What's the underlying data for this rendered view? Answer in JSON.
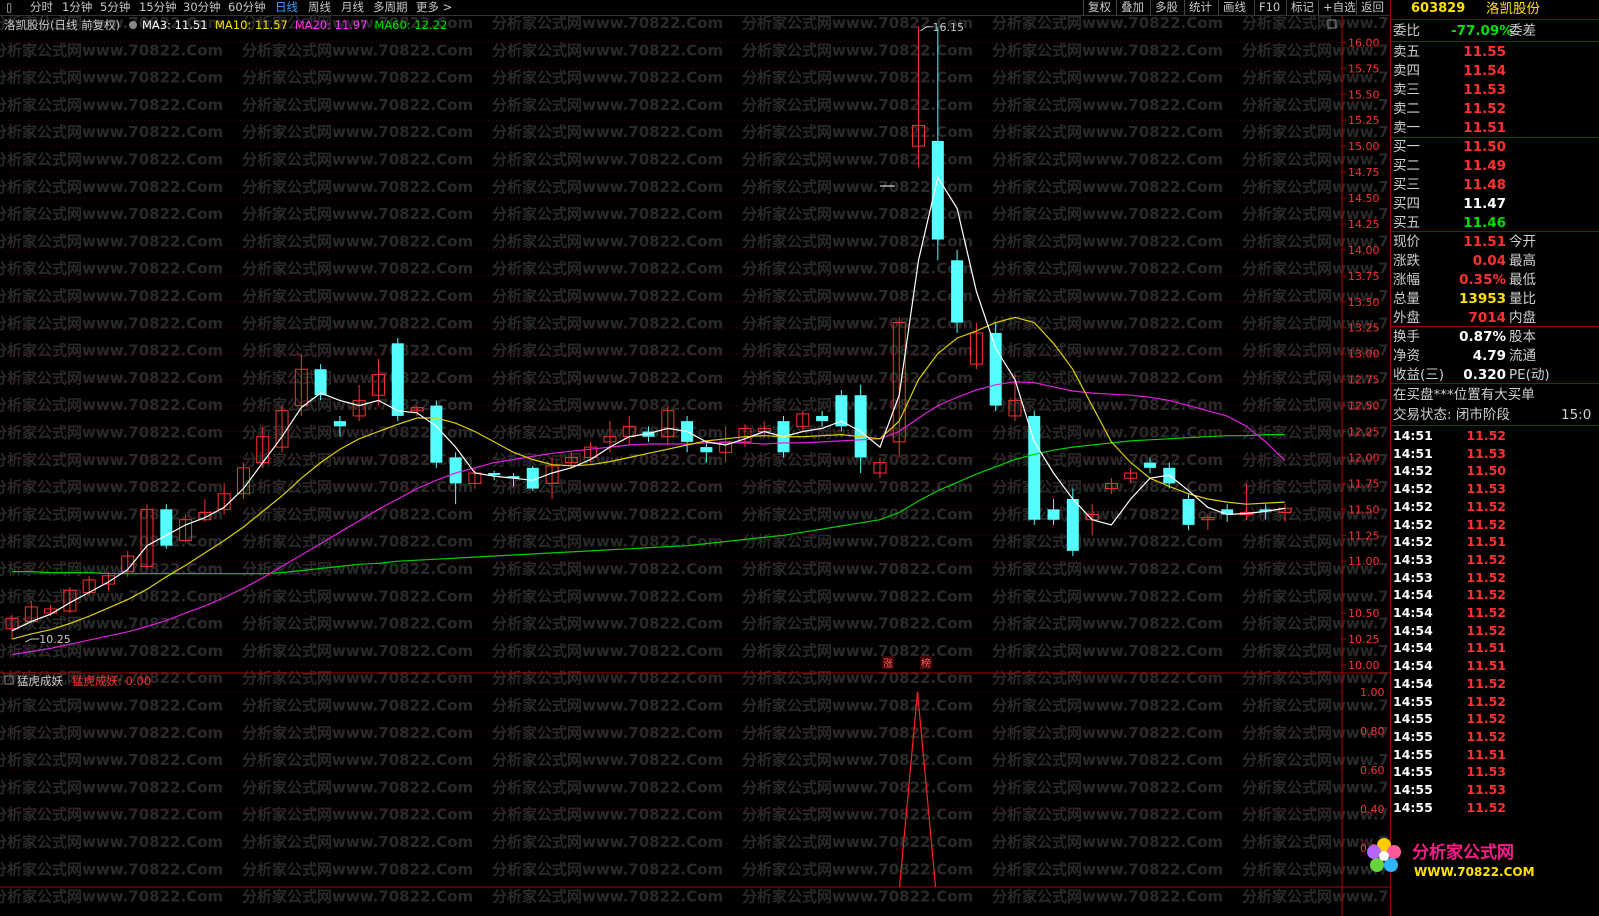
{
  "toolbar": {
    "periods": [
      "分时",
      "1分钟",
      "5分钟",
      "15分钟",
      "30分钟",
      "60分钟",
      "日线",
      "周线",
      "月线",
      "多周期",
      "更多 >"
    ],
    "active_period": "日线",
    "right": [
      "复权",
      "叠加",
      "多股",
      "统计",
      "画线",
      "F10",
      "标记",
      "+自选",
      "返回"
    ]
  },
  "main": {
    "title": "洛凯股份(日线 前复权)",
    "ma_labels": [
      {
        "text": "MA3: 11.51",
        "color": "#ffffff"
      },
      {
        "text": "MA10: 11.57",
        "color": "#ffe000"
      },
      {
        "text": "MA20: 11.97",
        "color": "#ff33ff"
      },
      {
        "text": "MA60: 12.22",
        "color": "#00e000"
      }
    ],
    "high_marker": "16.15",
    "low_marker": "10.25",
    "y_ticks": [
      "16.00",
      "15.75",
      "15.50",
      "15.25",
      "15.00",
      "14.75",
      "14.50",
      "14.25",
      "14.00",
      "13.75",
      "13.50",
      "13.25",
      "13.00",
      "12.75",
      "12.50",
      "12.25",
      "12.00",
      "11.75",
      "11.50",
      "11.25",
      "11.00",
      "10.50",
      "10.25",
      "10.00"
    ],
    "tags": [
      "涨",
      "榜"
    ]
  },
  "indicator": {
    "title": "猛虎成妖",
    "value_label": "猛虎成妖: 0.00",
    "y_ticks": [
      "1.00",
      "0.80",
      "0.60",
      "0.40",
      "0.20"
    ]
  },
  "watermark": "分析家公式网www.70822.Com",
  "panel": {
    "code": "603829",
    "name": "洛凯股份",
    "weibi_label": "委比",
    "weibi_value": "-77.09%",
    "weicha_label": "委差",
    "asks": [
      {
        "label": "卖五",
        "price": "11.55"
      },
      {
        "label": "卖四",
        "price": "11.54"
      },
      {
        "label": "卖三",
        "price": "11.53"
      },
      {
        "label": "卖二",
        "price": "11.52"
      },
      {
        "label": "卖一",
        "price": "11.51"
      }
    ],
    "bids": [
      {
        "label": "买一",
        "price": "11.50",
        "color": "red"
      },
      {
        "label": "买二",
        "price": "11.49",
        "color": "red"
      },
      {
        "label": "买三",
        "price": "11.48",
        "color": "red"
      },
      {
        "label": "买四",
        "price": "11.47",
        "color": "white"
      },
      {
        "label": "买五",
        "price": "11.46",
        "color": "green"
      }
    ],
    "stats": [
      {
        "label": "现价",
        "value": "11.51",
        "color": "red",
        "label2": "今开"
      },
      {
        "label": "涨跌",
        "value": "0.04",
        "color": "red",
        "label2": "最高"
      },
      {
        "label": "涨幅",
        "value": "0.35%",
        "color": "red",
        "label2": "最低"
      },
      {
        "label": "总量",
        "value": "13953",
        "color": "yellow",
        "label2": "量比"
      },
      {
        "label": "外盘",
        "value": "7014",
        "color": "red",
        "label2": "内盘"
      }
    ],
    "stats2": [
      {
        "label": "换手",
        "value": "0.87%",
        "label2": "股本"
      },
      {
        "label": "净资",
        "value": "4.79",
        "label2": "流通"
      },
      {
        "label": "收益(三)",
        "value": "0.320",
        "label2": "PE(动)"
      }
    ],
    "notice": "在买盘***位置有大买单",
    "status": "交易状态: 闭市阶段",
    "status_time": "15:0",
    "ticks": [
      {
        "time": "14:51",
        "price": "11.52"
      },
      {
        "time": "14:51",
        "price": "11.53"
      },
      {
        "time": "14:52",
        "price": "11.50"
      },
      {
        "time": "14:52",
        "price": "11.53"
      },
      {
        "time": "14:52",
        "price": "11.52"
      },
      {
        "time": "14:52",
        "price": "11.52"
      },
      {
        "time": "14:52",
        "price": "11.51"
      },
      {
        "time": "14:53",
        "price": "11.52"
      },
      {
        "time": "14:53",
        "price": "11.52"
      },
      {
        "time": "14:54",
        "price": "11.52"
      },
      {
        "time": "14:54",
        "price": "11.52"
      },
      {
        "time": "14:54",
        "price": "11.52"
      },
      {
        "time": "14:54",
        "price": "11.51"
      },
      {
        "time": "14:54",
        "price": "11.51"
      },
      {
        "time": "14:54",
        "price": "11.52"
      },
      {
        "time": "14:55",
        "price": "11.52"
      },
      {
        "time": "14:55",
        "price": "11.52"
      },
      {
        "time": "14:55",
        "price": "11.52"
      },
      {
        "time": "14:55",
        "price": "11.51"
      },
      {
        "time": "14:55",
        "price": "11.53"
      },
      {
        "time": "14:55",
        "price": "11.53"
      },
      {
        "time": "14:55",
        "price": "11.52"
      }
    ],
    "logo_text": "分析家公式网",
    "logo_url": "WWW.70822.COM"
  },
  "chart_data": {
    "type": "candlestick",
    "ylim": [
      10.0,
      16.1
    ],
    "candles": [
      [
        10.35,
        10.45,
        10.25,
        10.48
      ],
      [
        10.42,
        10.56,
        10.4,
        10.62
      ],
      [
        10.5,
        10.54,
        10.47,
        10.58
      ],
      [
        10.52,
        10.72,
        10.5,
        10.75
      ],
      [
        10.7,
        10.82,
        10.68,
        10.86
      ],
      [
        10.78,
        10.86,
        10.72,
        10.9
      ],
      [
        10.9,
        11.05,
        10.85,
        11.1
      ],
      [
        10.95,
        11.5,
        10.93,
        11.55
      ],
      [
        11.5,
        11.15,
        11.12,
        11.55
      ],
      [
        11.2,
        11.4,
        11.18,
        11.45
      ],
      [
        11.4,
        11.47,
        11.38,
        11.6
      ],
      [
        11.5,
        11.65,
        11.45,
        11.75
      ],
      [
        11.65,
        11.9,
        11.6,
        11.95
      ],
      [
        11.95,
        12.2,
        11.9,
        12.3
      ],
      [
        12.1,
        12.45,
        12.05,
        12.5
      ],
      [
        12.5,
        12.85,
        12.4,
        13.0
      ],
      [
        12.85,
        12.6,
        12.55,
        12.9
      ],
      [
        12.35,
        12.3,
        12.2,
        12.4
      ],
      [
        12.4,
        12.55,
        12.35,
        12.7
      ],
      [
        12.6,
        12.8,
        12.5,
        12.95
      ],
      [
        13.1,
        12.4,
        12.35,
        13.15
      ],
      [
        12.45,
        12.48,
        12.4,
        12.5
      ],
      [
        12.5,
        11.95,
        11.9,
        12.55
      ],
      [
        12.0,
        11.75,
        11.55,
        12.05
      ],
      [
        11.75,
        11.85,
        11.7,
        11.9
      ],
      [
        11.85,
        11.83,
        11.78,
        11.87
      ],
      [
        11.82,
        11.8,
        11.72,
        11.85
      ],
      [
        11.9,
        11.7,
        11.68,
        11.92
      ],
      [
        11.75,
        11.92,
        11.6,
        12.0
      ],
      [
        11.95,
        12.0,
        11.9,
        12.05
      ],
      [
        12.0,
        12.1,
        11.95,
        12.15
      ],
      [
        12.15,
        12.2,
        12.05,
        12.35
      ],
      [
        12.2,
        12.3,
        12.12,
        12.4
      ],
      [
        12.25,
        12.2,
        12.15,
        12.3
      ],
      [
        12.2,
        12.45,
        12.12,
        12.5
      ],
      [
        12.35,
        12.15,
        12.05,
        12.4
      ],
      [
        12.1,
        12.05,
        11.95,
        12.15
      ],
      [
        12.05,
        12.15,
        11.95,
        12.3
      ],
      [
        12.15,
        12.28,
        12.1,
        12.32
      ],
      [
        12.25,
        12.28,
        12.2,
        12.35
      ],
      [
        12.35,
        12.05,
        12.0,
        12.4
      ],
      [
        12.3,
        12.42,
        12.25,
        12.45
      ],
      [
        12.4,
        12.35,
        12.3,
        12.45
      ],
      [
        12.6,
        12.3,
        12.25,
        12.65
      ],
      [
        12.6,
        12.0,
        11.85,
        12.7
      ],
      [
        11.85,
        11.95,
        11.8,
        12.0
      ],
      [
        12.15,
        13.3,
        12.0,
        13.35
      ],
      [
        15.0,
        15.2,
        14.8,
        16.15
      ],
      [
        15.05,
        14.1,
        13.9,
        16.15
      ],
      [
        13.9,
        13.3,
        13.2,
        14.0
      ],
      [
        12.9,
        13.2,
        12.85,
        13.3
      ],
      [
        13.2,
        12.5,
        12.45,
        13.3
      ],
      [
        12.4,
        12.55,
        12.35,
        12.8
      ],
      [
        12.4,
        11.4,
        11.35,
        12.45
      ],
      [
        11.5,
        11.4,
        11.35,
        11.6
      ],
      [
        11.6,
        11.1,
        11.05,
        11.7
      ],
      [
        11.4,
        11.45,
        11.25,
        11.55
      ],
      [
        11.7,
        11.75,
        11.65,
        11.8
      ],
      [
        11.8,
        11.85,
        11.75,
        11.9
      ],
      [
        11.95,
        11.9,
        11.85,
        12.0
      ],
      [
        11.9,
        11.75,
        11.7,
        11.95
      ],
      [
        11.6,
        11.35,
        11.3,
        11.65
      ],
      [
        11.4,
        11.42,
        11.3,
        11.45
      ],
      [
        11.5,
        11.45,
        11.38,
        11.55
      ],
      [
        11.45,
        11.47,
        11.4,
        11.75
      ],
      [
        11.5,
        11.48,
        11.4,
        11.55
      ],
      [
        11.47,
        11.51,
        11.38,
        11.55
      ]
    ],
    "ma3": [
      10.33,
      10.42,
      10.49,
      10.6,
      10.7,
      10.8,
      10.92,
      11.15,
      11.25,
      11.35,
      11.42,
      11.52,
      11.7,
      11.95,
      12.2,
      12.48,
      12.62,
      12.55,
      12.5,
      12.55,
      12.45,
      12.43,
      12.3,
      12.1,
      11.85,
      11.82,
      11.8,
      11.78,
      11.85,
      11.9,
      11.98,
      12.1,
      12.2,
      12.23,
      12.28,
      12.25,
      12.15,
      12.12,
      12.18,
      12.25,
      12.2,
      12.25,
      12.28,
      12.35,
      12.25,
      12.1,
      12.6,
      13.9,
      14.7,
      14.4,
      13.6,
      13.05,
      12.75,
      12.15,
      11.85,
      11.6,
      11.4,
      11.35,
      11.6,
      11.8,
      11.83,
      11.68,
      11.52,
      11.45,
      11.46,
      11.48,
      11.51
    ],
    "ma10": [
      10.25,
      10.3,
      10.34,
      10.4,
      10.47,
      10.55,
      10.63,
      10.73,
      10.85,
      10.96,
      11.08,
      11.2,
      11.33,
      11.48,
      11.63,
      11.8,
      11.95,
      12.08,
      12.18,
      12.25,
      12.32,
      12.38,
      12.38,
      12.33,
      12.25,
      12.15,
      12.05,
      11.98,
      11.93,
      11.92,
      11.93,
      11.96,
      12.0,
      12.04,
      12.08,
      12.12,
      12.16,
      12.18,
      12.2,
      12.21,
      12.2,
      12.2,
      12.21,
      12.22,
      12.2,
      12.18,
      12.35,
      12.75,
      13.0,
      13.15,
      13.22,
      13.3,
      13.35,
      13.3,
      13.1,
      12.85,
      12.5,
      12.15,
      11.95,
      11.8,
      11.72,
      11.65,
      11.6,
      11.57,
      11.55,
      11.56,
      11.57
    ],
    "ma20": [
      10.1,
      10.13,
      10.16,
      10.2,
      10.24,
      10.28,
      10.32,
      10.37,
      10.43,
      10.5,
      10.57,
      10.65,
      10.74,
      10.84,
      10.95,
      11.06,
      11.17,
      11.28,
      11.39,
      11.5,
      11.6,
      11.7,
      11.78,
      11.85,
      11.9,
      11.95,
      11.98,
      12.01,
      12.04,
      12.06,
      12.08,
      12.1,
      12.12,
      12.13,
      12.13,
      12.13,
      12.14,
      12.14,
      12.14,
      12.13,
      12.14,
      12.14,
      12.15,
      12.16,
      12.17,
      12.18,
      12.25,
      12.38,
      12.5,
      12.58,
      12.65,
      12.7,
      12.73,
      12.72,
      12.68,
      12.64,
      12.62,
      12.61,
      12.6,
      12.58,
      12.55,
      12.5,
      12.45,
      12.4,
      12.3,
      12.15,
      11.97
    ],
    "ma60": [
      10.9,
      10.9,
      10.89,
      10.89,
      10.89,
      10.88,
      10.88,
      10.88,
      10.88,
      10.88,
      10.88,
      10.88,
      10.88,
      10.88,
      10.89,
      10.91,
      10.93,
      10.95,
      10.97,
      10.98,
      11.0,
      11.01,
      11.02,
      11.03,
      11.04,
      11.05,
      11.06,
      11.07,
      11.08,
      11.09,
      11.1,
      11.11,
      11.12,
      11.13,
      11.14,
      11.15,
      11.17,
      11.19,
      11.21,
      11.23,
      11.25,
      11.28,
      11.31,
      11.34,
      11.37,
      11.4,
      11.47,
      11.58,
      11.68,
      11.76,
      11.84,
      11.91,
      11.98,
      12.03,
      12.07,
      12.1,
      12.12,
      12.14,
      12.16,
      12.17,
      12.18,
      12.19,
      12.2,
      12.21,
      12.21,
      12.22,
      12.22
    ],
    "indicator": {
      "spike_index": 47,
      "value": 0.0
    }
  }
}
